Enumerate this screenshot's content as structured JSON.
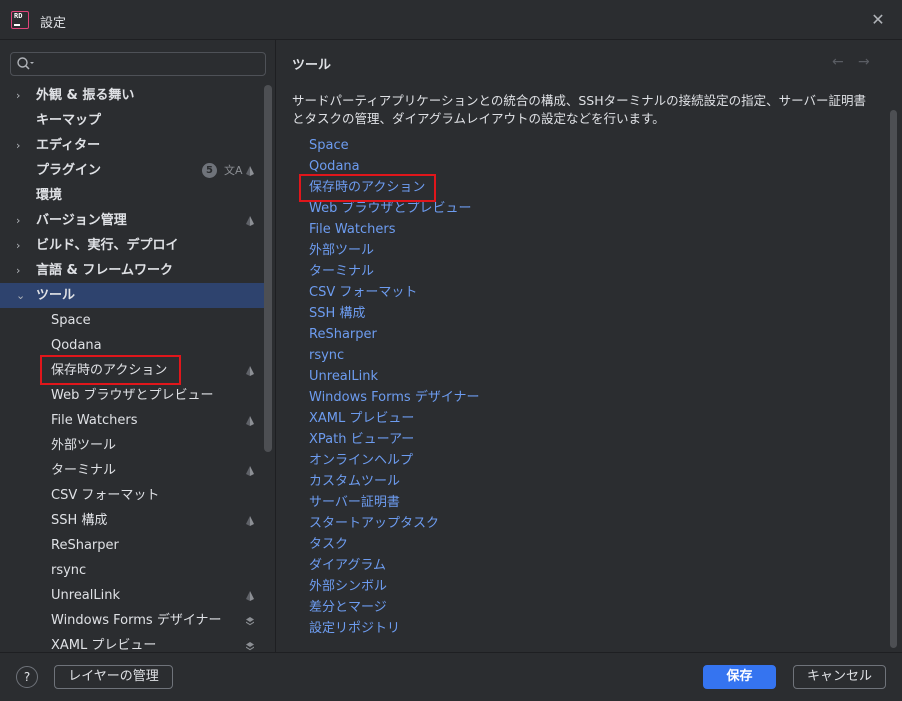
{
  "window": {
    "title": "設定"
  },
  "search": {
    "value": "",
    "placeholder": ""
  },
  "tree": {
    "items": [
      {
        "label": "外観 & 振る舞い",
        "chevron": "›"
      },
      {
        "label": "キーマップ"
      },
      {
        "label": "エディター",
        "chevron": "›"
      },
      {
        "label": "プラグイン",
        "badge": "5",
        "translate_icon": "文A"
      },
      {
        "label": "環境"
      },
      {
        "label": "バージョン管理",
        "chevron": "›"
      },
      {
        "label": "ビルド、実行、デプロイ",
        "chevron": "›"
      },
      {
        "label": "言語 & フレームワーク",
        "chevron": "›"
      },
      {
        "label": "ツール",
        "chevron": "⌄"
      },
      {
        "label": "Space"
      },
      {
        "label": "Qodana"
      },
      {
        "label": "保存時のアクション"
      },
      {
        "label": "Web ブラウザとプレビュー"
      },
      {
        "label": "File Watchers"
      },
      {
        "label": "外部ツール"
      },
      {
        "label": "ターミナル"
      },
      {
        "label": "CSV フォーマット"
      },
      {
        "label": "SSH 構成"
      },
      {
        "label": "ReSharper"
      },
      {
        "label": "rsync"
      },
      {
        "label": "UnrealLink"
      },
      {
        "label": "Windows Forms デザイナー"
      },
      {
        "label": "XAML プレビュー"
      }
    ]
  },
  "main": {
    "title": "ツール",
    "nav_back": "←",
    "nav_forward": "→",
    "description": "サードパーティアプリケーションとの統合の構成、SSHターミナルの接続設定の指定、サーバー証明書とタスクの管理、ダイアグラムレイアウトの設定などを行います。",
    "links": [
      "Space",
      "Qodana",
      "保存時のアクション",
      "Web ブラウザとプレビュー",
      "File Watchers",
      "外部ツール",
      "ターミナル",
      "CSV フォーマット",
      "SSH 構成",
      "ReSharper",
      "rsync",
      "UnrealLink",
      "Windows Forms デザイナー",
      "XAML プレビュー",
      "XPath ビューアー",
      "オンラインヘルプ",
      "カスタムツール",
      "サーバー証明書",
      "スタートアップタスク",
      "タスク",
      "ダイアグラム",
      "外部シンボル",
      "差分とマージ",
      "設定リポジトリ"
    ]
  },
  "footer": {
    "help": "?",
    "manage_layers": "レイヤーの管理",
    "save": "保存",
    "cancel": "キャンセル"
  },
  "app_logo": "RD",
  "colors": {
    "background": "#2b2d30",
    "selection": "#2e436e",
    "link": "#6d9cf0",
    "primary_button": "#3574f0",
    "highlight_box": "#e0161b"
  }
}
